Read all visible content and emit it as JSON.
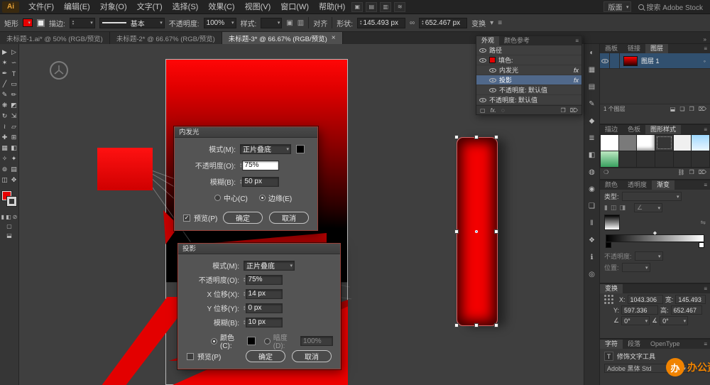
{
  "colors": {
    "red": "#e60000",
    "watermark": "#f08300",
    "selection-blue": "#31506f",
    "appearance-highlight": "#50688a"
  },
  "app": {
    "brand": "Ai",
    "workspace": "版面",
    "search_label": "搜索 Adobe Stock",
    "collapse_icon": "»",
    "panel_menu_icon": "≡"
  },
  "menubar": {
    "items": [
      {
        "name": "menu-file",
        "label": "文件(F)"
      },
      {
        "name": "menu-edit",
        "label": "编辑(E)"
      },
      {
        "name": "menu-object",
        "label": "对象(O)"
      },
      {
        "name": "menu-type",
        "label": "文字(T)"
      },
      {
        "name": "menu-select",
        "label": "选择(S)"
      },
      {
        "name": "menu-effect",
        "label": "效果(C)"
      },
      {
        "name": "menu-view",
        "label": "视图(V)"
      },
      {
        "name": "menu-window",
        "label": "窗口(W)"
      },
      {
        "name": "menu-help",
        "label": "帮助(H)"
      }
    ]
  },
  "controlbar": {
    "tool_name": "矩形",
    "stroke_label": "描边:",
    "brush_value": "基本",
    "opacity_label": "不透明度:",
    "opacity_value": "100%",
    "style_label": "样式:",
    "align_label": "对齐",
    "shape_label": "形状:",
    "w_value": "145.493 px",
    "h_value": "652.467 px",
    "transform_label": "变换"
  },
  "doc_tabs": [
    {
      "label": "未标题-1.ai* @ 50% (RGB/预览)"
    },
    {
      "label": "未标题-2* @ 66.67% (RGB/预览)"
    },
    {
      "label": "未标题-3* @ 66.67% (RGB/预览)",
      "close": "×"
    }
  ],
  "toolbar": {
    "tools": [
      {
        "name": "selection-tool",
        "glyph": "▶"
      },
      {
        "name": "direct-selection-tool",
        "glyph": "▷"
      },
      {
        "name": "magic-wand-tool",
        "glyph": "✶"
      },
      {
        "name": "lasso-tool",
        "glyph": "∽"
      },
      {
        "name": "pen-tool",
        "glyph": "✒"
      },
      {
        "name": "type-tool",
        "glyph": "T"
      },
      {
        "name": "line-segment-tool",
        "glyph": "╱"
      },
      {
        "name": "rectangle-tool",
        "glyph": "▭"
      },
      {
        "name": "paintbrush-tool",
        "glyph": "✎"
      },
      {
        "name": "pencil-tool",
        "glyph": "✏"
      },
      {
        "name": "blob-brush-tool",
        "glyph": "❋"
      },
      {
        "name": "eraser-tool",
        "glyph": "◩"
      },
      {
        "name": "rotate-tool",
        "glyph": "↻"
      },
      {
        "name": "scale-tool",
        "glyph": "⇲"
      },
      {
        "name": "width-tool",
        "glyph": "≀"
      },
      {
        "name": "free-transform-tool",
        "glyph": "▱"
      },
      {
        "name": "shape-builder-tool",
        "glyph": "✚"
      },
      {
        "name": "perspective-grid-tool",
        "glyph": "⊞"
      },
      {
        "name": "mesh-tool",
        "glyph": "▦"
      },
      {
        "name": "gradient-tool",
        "glyph": "◧"
      },
      {
        "name": "eyedropper-tool",
        "glyph": "✧"
      },
      {
        "name": "blend-tool",
        "glyph": "✦"
      },
      {
        "name": "symbol-sprayer-tool",
        "glyph": "⊚"
      },
      {
        "name": "column-graph-tool",
        "glyph": "▤"
      },
      {
        "name": "artboard-tool",
        "glyph": "◫"
      },
      {
        "name": "hand-tool",
        "glyph": "✥"
      }
    ]
  },
  "dialogs": {
    "inner_glow": {
      "title": "内发光",
      "mode_label": "模式(M):",
      "mode_value": "正片叠底",
      "opacity_label": "不透明度(O):",
      "opacity_value": "75%",
      "blur_label": "模糊(B):",
      "blur_value": "50 px",
      "center_label": "中心(C)",
      "edge_label": "边缘(E)",
      "preview_label": "预览(P)",
      "ok_label": "确定",
      "cancel_label": "取消"
    },
    "drop_shadow": {
      "title": "投影",
      "mode_label": "模式(M):",
      "mode_value": "正片叠底",
      "opacity_label": "不透明度(O):",
      "opacity_value": "75%",
      "x_label": "X 位移(X):",
      "x_value": "14 px",
      "y_label": "Y 位移(Y):",
      "y_value": "0 px",
      "blur_label": "模糊(B):",
      "blur_value": "10 px",
      "color_label": "颜色(C):",
      "darkness_label": "暗度(D):",
      "darkness_value": "100%",
      "preview_label": "预览(P)",
      "ok_label": "确定",
      "cancel_label": "取消"
    }
  },
  "appearance": {
    "tab_appearance": "外观",
    "tab_color_guide": "颜色参考",
    "fx": "fx",
    "rows": {
      "path": "路径",
      "fill": "填色:",
      "inner_glow": "内发光",
      "drop_shadow": "投影",
      "opacity_fill": "不透明度: 默认值",
      "opacity_path": "不透明度: 默认值"
    }
  },
  "dock": {
    "icon_strip": [
      {
        "name": "color-panel-icon",
        "glyph": "◐"
      },
      {
        "name": "color-guide-panel-icon",
        "glyph": "▦"
      },
      {
        "name": "swatches-panel-icon",
        "glyph": "▤"
      },
      {
        "name": "brushes-panel-icon",
        "glyph": "✎"
      },
      {
        "name": "symbols-panel-icon",
        "glyph": "◆"
      },
      {
        "name": "stroke-panel-icon",
        "glyph": "≣"
      },
      {
        "name": "gradient-panel-icon",
        "glyph": "◧"
      },
      {
        "name": "transparency-panel-icon",
        "glyph": "◍"
      },
      {
        "name": "appearance-panel-icon",
        "glyph": "◉"
      },
      {
        "name": "graphic-styles-panel-icon",
        "glyph": "❑"
      },
      {
        "name": "align-panel-icon",
        "glyph": "‖"
      },
      {
        "name": "pathfinder-panel-icon",
        "glyph": "❖"
      },
      {
        "name": "info-panel-icon",
        "glyph": "ℹ"
      },
      {
        "name": "navigator-panel-icon",
        "glyph": "◎"
      }
    ],
    "layers": {
      "tab_artboards": "画板",
      "tab_links": "链接",
      "tab_layers": "图层",
      "layer_name": "图层 1",
      "footer": "1 个图层"
    },
    "graphic_styles": {
      "tab_stroke": "描边",
      "tab_swatches": "色板",
      "tab_styles": "图形样式",
      "swatches": [
        "background:#ffffff",
        "background:rgba(230,230,230,0.45)",
        "background:#ffffff;box-shadow:inset -2px -3px 4px rgba(0,0,0,0.35)",
        "background:#353535;outline:1px dotted #aaa;outline-offset:-3px",
        "background:#f0f0f0",
        "background:linear-gradient(180deg,#9fd8ff 0%,#eaf6ff 100%)",
        "background:linear-gradient(180deg,#bde8c2 0%,#39a05f 100%)",
        "background:#303030",
        "background:#303030",
        "background:#303030",
        "background:#303030",
        "background:#303030"
      ]
    },
    "gradient": {
      "tab_color": "颜色",
      "tab_transparency": "透明度",
      "tab_gradient": "渐变",
      "type_label": "类型:",
      "opacity_label": "不透明度:",
      "location_label": "位置:"
    },
    "transform": {
      "title": "变换",
      "x_label": "X:",
      "x_value": "1043.306",
      "y_label": "Y:",
      "y_value": "597.336",
      "w_label": "宽:",
      "w_value": "145.493",
      "h_label": "高:",
      "h_value": "652.467",
      "rotate_value": "0°",
      "shear_value": "0°"
    },
    "character": {
      "tab_character": "字符",
      "tab_paragraph": "段落",
      "tab_opentype": "OpenType",
      "touch_label": "修饰文字工具",
      "font_value": "Adobe 黑体 Std"
    }
  },
  "watermark": {
    "text": "办公资源",
    "initial": "办"
  }
}
